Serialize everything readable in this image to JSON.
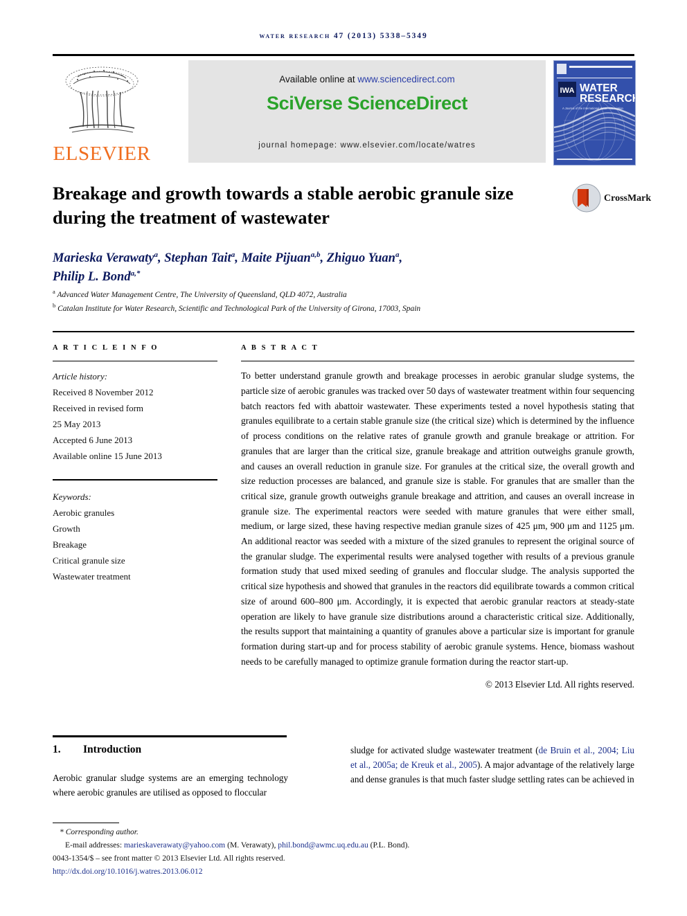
{
  "running_head": "water research 47 (2013) 5338–5349",
  "masthead": {
    "elsevier_wordmark": "ELSEVIER",
    "available_prefix": "Available online at ",
    "available_url": "www.sciencedirect.com",
    "sciverse_logo": "SciVerse ScienceDirect",
    "journal_homepage": "journal homepage: www.elsevier.com/locate/watres",
    "cover": {
      "title_line1": "WATER",
      "title_line2": "RESEARCH",
      "subtitle": "A Journal of the International Water Association",
      "iwa_logo": "IWA"
    }
  },
  "crossmark": {
    "label": "CrossMark"
  },
  "article": {
    "title": "Breakage and growth towards a stable aerobic granule size during the treatment of wastewater",
    "authors_line1_pre": "Marieska Verawaty",
    "authors": "Marieska Verawaty a, Stephan Tait a, Maite Pijuan a,b, Zhiguo Yuan a, Philip L. Bond a,*",
    "affiliation_a": "Advanced Water Management Centre, The University of Queensland, QLD 4072, Australia",
    "affiliation_b": "Catalan Institute for Water Research, Scientific and Technological Park of the University of Girona, 17003, Spain"
  },
  "article_info": {
    "heading": "A R T I C L E   I N F O",
    "history_label": "Article history:",
    "history": [
      "Received 8 November 2012",
      "Received in revised form",
      "25 May 2013",
      "Accepted 6 June 2013",
      "Available online 15 June 2013"
    ],
    "keywords_label": "Keywords:",
    "keywords": [
      "Aerobic granules",
      "Growth",
      "Breakage",
      "Critical granule size",
      "Wastewater treatment"
    ]
  },
  "abstract": {
    "heading": "A B S T R A C T",
    "text": "To better understand granule growth and breakage processes in aerobic granular sludge systems, the particle size of aerobic granules was tracked over 50 days of wastewater treatment within four sequencing batch reactors fed with abattoir wastewater. These experiments tested a novel hypothesis stating that granules equilibrate to a certain stable granule size (the critical size) which is determined by the influence of process conditions on the relative rates of granule growth and granule breakage or attrition. For granules that are larger than the critical size, granule breakage and attrition outweighs granule growth, and causes an overall reduction in granule size. For granules at the critical size, the overall growth and size reduction processes are balanced, and granule size is stable. For granules that are smaller than the critical size, granule growth outweighs granule breakage and attrition, and causes an overall increase in granule size. The experimental reactors were seeded with mature granules that were either small, medium, or large sized, these having respective median granule sizes of 425 μm, 900 μm and 1125 μm. An additional reactor was seeded with a mixture of the sized granules to represent the original source of the granular sludge. The experimental results were analysed together with results of a previous granule formation study that used mixed seeding of granules and floccular sludge. The analysis supported the critical size hypothesis and showed that granules in the reactors did equilibrate towards a common critical size of around 600–800 μm. Accordingly, it is expected that aerobic granular reactors at steady-state operation are likely to have granule size distributions around a characteristic critical size. Additionally, the results support that maintaining a quantity of granules above a particular size is important for granule formation during start-up and for process stability of aerobic granule systems. Hence, biomass washout needs to be carefully managed to optimize granule formation during the reactor start-up.",
    "copyright": "© 2013 Elsevier Ltd. All rights reserved."
  },
  "introduction": {
    "number": "1.",
    "heading": "Introduction",
    "left_text": "Aerobic granular sludge systems are an emerging technology where aerobic granules are utilised as opposed to floccular",
    "right_pre": "sludge for activated sludge wastewater treatment (",
    "right_citation": "de Bruin et al., 2004; Liu et al., 2005a; de Kreuk et al., 2005",
    "right_post": "). A major advantage of the relatively large and dense granules is that much faster sludge settling rates can be achieved in"
  },
  "footer": {
    "corresponding": "* Corresponding author.",
    "email_label": "E-mail addresses: ",
    "email1": "marieskaverawaty@yahoo.com",
    "email1_name": " (M. Verawaty), ",
    "email2": "phil.bond@awmc.uq.edu.au",
    "email2_name": " (P.L. Bond).",
    "issn_line": "0043-1354/$ – see front matter © 2013 Elsevier Ltd. All rights reserved.",
    "doi": "http://dx.doi.org/10.1016/j.watres.2013.06.012"
  }
}
